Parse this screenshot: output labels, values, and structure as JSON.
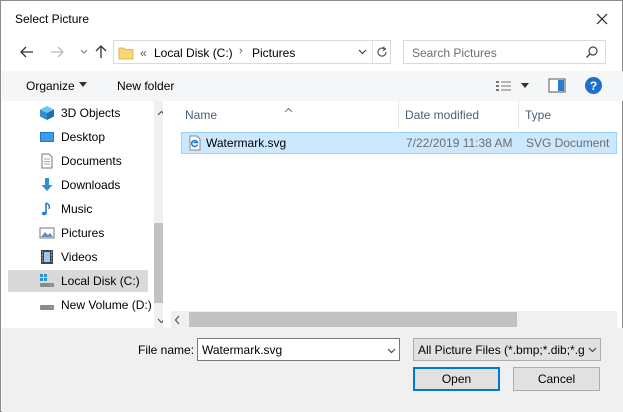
{
  "window": {
    "title": "Select Picture",
    "close_icon": "close-icon"
  },
  "nav": {
    "back_icon": "arrow-left-icon",
    "forward_icon": "arrow-right-icon",
    "up_icon": "arrow-up-icon",
    "address": {
      "overflow": "«",
      "crumbs": [
        "Local Disk (C:)",
        "Pictures"
      ],
      "separator": "›"
    },
    "search_placeholder": "Search Pictures"
  },
  "toolbar": {
    "organize_label": "Organize",
    "new_folder_label": "New folder",
    "help_label": "?"
  },
  "sidebar": {
    "items": [
      {
        "label": "3D Objects",
        "icon": "3d-objects-icon",
        "selected": false
      },
      {
        "label": "Desktop",
        "icon": "desktop-icon",
        "selected": false
      },
      {
        "label": "Documents",
        "icon": "documents-icon",
        "selected": false
      },
      {
        "label": "Downloads",
        "icon": "downloads-icon",
        "selected": false
      },
      {
        "label": "Music",
        "icon": "music-icon",
        "selected": false
      },
      {
        "label": "Pictures",
        "icon": "pictures-icon",
        "selected": false
      },
      {
        "label": "Videos",
        "icon": "videos-icon",
        "selected": false
      },
      {
        "label": "Local Disk (C:)",
        "icon": "local-disk-icon",
        "selected": true
      },
      {
        "label": "New Volume (D:)",
        "icon": "drive-icon",
        "selected": false
      }
    ]
  },
  "files": {
    "columns": [
      "Name",
      "Date modified",
      "Type"
    ],
    "rows": [
      {
        "name": "Watermark.svg",
        "date": "7/22/2019 11:38 AM",
        "type": "SVG Document",
        "icon": "edge-file-icon",
        "selected": true
      }
    ]
  },
  "bottom": {
    "file_name_label": "File name:",
    "file_name_value": "Watermark.svg",
    "filter_value": "All Picture Files (*.bmp;*.dib;*.gif;*.jpg;*.png)",
    "open_label": "Open",
    "cancel_label": "Cancel"
  },
  "colors": {
    "selection": "#cce8ff",
    "selection_border": "#99d1ff",
    "accent": "#0078d7",
    "header_text": "#4c607a"
  }
}
